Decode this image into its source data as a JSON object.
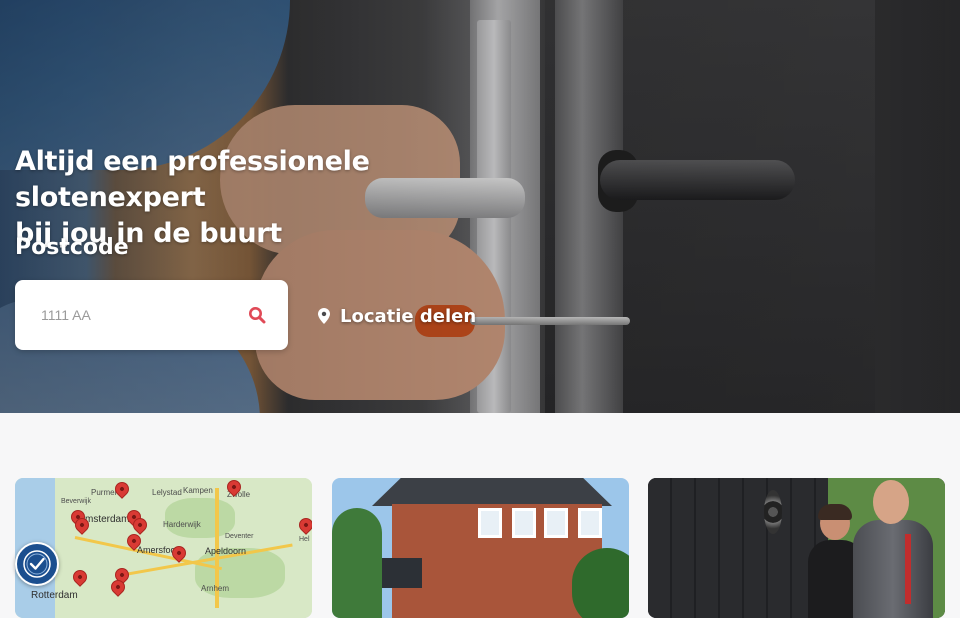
{
  "hero": {
    "title_line1": "Altijd een professionele slotenexpert",
    "title_line2": "bij jou in de buurt",
    "postcode_label": "Postcode",
    "postcode_placeholder": "1111 AA",
    "postcode_value": "",
    "search_icon": "search-icon",
    "location_icon": "map-pin-icon",
    "location_button_label": "Locatie delen"
  },
  "colors": {
    "accent": "#e04a57",
    "white": "#ffffff",
    "page_background": "#f7f7f8",
    "pin_red": "#d93a34"
  },
  "cards": {
    "map": {
      "labels": {
        "purmer": "Purmer",
        "lelystad": "Lelystad",
        "kampen": "Kampen",
        "zwolle": "Zwolle",
        "beverwijk": "Beverwijk",
        "amsterdam": "msterdam",
        "harderwijk": "Harderwijk",
        "hellendoorn": "Hel",
        "amersfoort": "Amersfoort",
        "apeldoorn": "Apeldoorn",
        "deventer": "Deventer",
        "rotterdam": "Rotterdam",
        "arnhem": "Arnhem"
      },
      "badge_icon": "shield-check-icon"
    },
    "house": {
      "image_alt": "house"
    },
    "team": {
      "image_alt": "team"
    }
  }
}
